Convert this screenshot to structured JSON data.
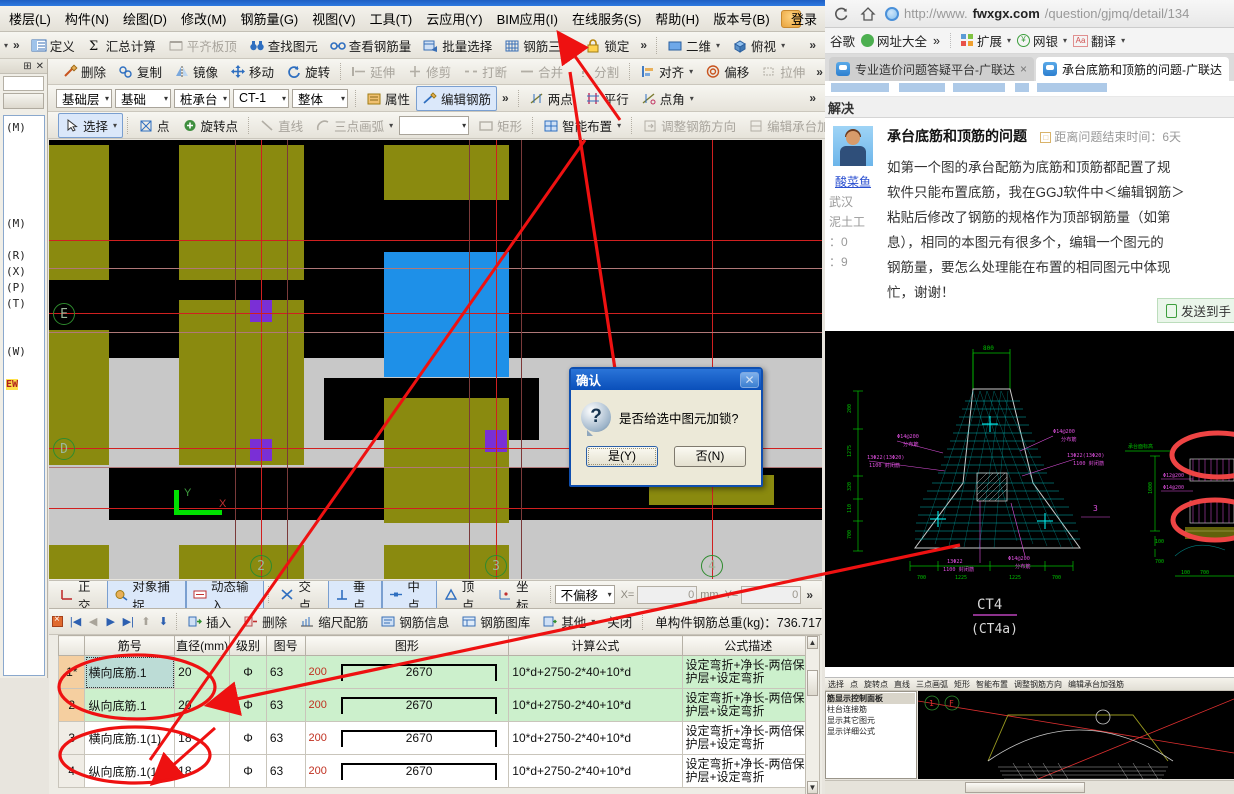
{
  "app": {
    "menu": [
      "楼层(L)",
      "构件(N)",
      "绘图(D)",
      "修改(M)",
      "钢筋量(G)",
      "视图(V)",
      "工具(T)",
      "云应用(Y)",
      "BIM应用(I)",
      "在线服务(S)",
      "帮助(H)",
      "版本号(B)"
    ],
    "login_label": "登录",
    "toolbar1": [
      {
        "label": "定义",
        "icon": "define-icon",
        "disabled": false
      },
      {
        "label": "汇总计算",
        "icon": "sigma-icon",
        "disabled": false
      },
      {
        "label": "平齐板顶",
        "icon": "align-slab-icon",
        "disabled": true
      },
      {
        "label": "查找图元",
        "icon": "binoculars-icon",
        "disabled": false
      },
      {
        "label": "查看钢筋量",
        "icon": "glasses-icon",
        "disabled": false
      },
      {
        "label": "批量选择",
        "icon": "batch-select-icon",
        "disabled": false
      },
      {
        "label": "钢筋三维",
        "icon": "rebar-3d-icon",
        "disabled": false
      },
      {
        "label": "锁定",
        "icon": "lock-icon",
        "disabled": false
      }
    ],
    "view_controls": [
      {
        "label": "二维",
        "icon": "plane-2d-icon"
      },
      {
        "label": "俯视",
        "icon": "cube-top-icon"
      }
    ],
    "toolbar2": [
      {
        "label": "删除",
        "icon": "delete-icon",
        "disabled": false
      },
      {
        "label": "复制",
        "icon": "copy-icon",
        "disabled": false
      },
      {
        "label": "镜像",
        "icon": "mirror-icon",
        "disabled": false
      },
      {
        "label": "移动",
        "icon": "move-icon",
        "disabled": false
      },
      {
        "label": "旋转",
        "icon": "rotate-icon",
        "disabled": false
      },
      {
        "label": "延伸",
        "icon": "extend-icon",
        "disabled": true
      },
      {
        "label": "修剪",
        "icon": "trim-icon",
        "disabled": true
      },
      {
        "label": "打断",
        "icon": "break-icon",
        "disabled": true
      },
      {
        "label": "合并",
        "icon": "merge-icon",
        "disabled": true
      },
      {
        "label": "分割",
        "icon": "split-icon",
        "disabled": true
      },
      {
        "label": "对齐",
        "icon": "align-icon",
        "disabled": false
      },
      {
        "label": "偏移",
        "icon": "offset-icon",
        "disabled": false
      },
      {
        "label": "拉伸",
        "icon": "stretch-icon",
        "disabled": true
      }
    ],
    "toolbar3_selects": [
      "基础层",
      "基础",
      "桩承台",
      "CT-1",
      "整体"
    ],
    "toolbar3_buttons": [
      {
        "label": "属性",
        "icon": "properties-icon",
        "selected": false
      },
      {
        "label": "编辑钢筋",
        "icon": "edit-rebar-icon",
        "selected": true
      }
    ],
    "toolbar3_right": [
      {
        "label": "两点",
        "icon": "two-point-icon"
      },
      {
        "label": "平行",
        "icon": "parallel-icon"
      },
      {
        "label": "点角",
        "icon": "point-angle-icon"
      }
    ],
    "toolbar4": [
      {
        "label": "选择",
        "icon": "cursor-icon",
        "disabled": false,
        "selected": true
      },
      {
        "label": "点",
        "icon": "point-icon",
        "disabled": false
      },
      {
        "label": "旋转点",
        "icon": "rotate-point-icon",
        "disabled": false
      },
      {
        "label": "直线",
        "icon": "line-icon",
        "disabled": true
      },
      {
        "label": "三点画弧",
        "icon": "arc-3point-icon",
        "disabled": true
      },
      {
        "label": "矩形",
        "icon": "rectangle-icon",
        "disabled": true
      },
      {
        "label": "智能布置",
        "icon": "smart-layout-icon",
        "disabled": false
      },
      {
        "label": "调整钢筋方向",
        "icon": "adjust-rebar-dir-icon",
        "disabled": true
      },
      {
        "label": "编辑承台加强筋",
        "icon": "edit-cap-rebar-icon",
        "disabled": true
      }
    ],
    "left_dock": {
      "pin_icon": "pin-icon",
      "close_icon": "close-icon",
      "tree_lines": [
        "",
        "(M)",
        "",
        "",
        "",
        "",
        "",
        "(M)",
        "",
        "(R)",
        "(X)",
        "(P)",
        "(T)",
        "",
        "",
        "(W)",
        "",
        "EW"
      ]
    },
    "snapbar": [
      {
        "label": "正交",
        "icon": "ortho-icon",
        "on": false
      },
      {
        "label": "对象捕捉",
        "icon": "object-snap-icon",
        "on": true
      },
      {
        "label": "动态输入",
        "icon": "dynamic-input-icon",
        "on": true
      },
      {
        "label": "交点",
        "icon": "intersection-icon",
        "on": false
      },
      {
        "label": "垂点",
        "icon": "perpendicular-icon",
        "on": true
      },
      {
        "label": "中点",
        "icon": "midpoint-icon",
        "on": true
      },
      {
        "label": "顶点",
        "icon": "vertex-icon",
        "on": false
      },
      {
        "label": "坐标",
        "icon": "coordinate-icon",
        "on": false
      }
    ],
    "offset_mode": "不偏移",
    "x_label": "X=",
    "x_value": "0",
    "unit": "mm",
    "y_label": "Y=",
    "y_value": "0",
    "cad": {
      "axis_labels": [
        "E",
        "D",
        "2",
        "3",
        "4"
      ],
      "ucs_x": "X",
      "ucs_y": "Y"
    },
    "dialog": {
      "title": "确认",
      "message": "是否给选中图元加锁?",
      "yes_label": "是(Y)",
      "no_label": "否(N)",
      "close_label": "✕",
      "question_icon": "question-icon"
    },
    "rebar_editor": {
      "toolbar": [
        {
          "label": "插入",
          "icon": "insert-row-icon"
        },
        {
          "label": "删除",
          "icon": "delete-row-icon"
        },
        {
          "label": "缩尺配筋",
          "icon": "scale-rebar-icon"
        },
        {
          "label": "钢筋信息",
          "icon": "rebar-info-icon"
        },
        {
          "label": "钢筋图库",
          "icon": "rebar-library-icon"
        },
        {
          "label": "其他",
          "icon": "other-icon"
        },
        {
          "label": "关闭",
          "icon": "close-panel-icon"
        }
      ],
      "total_label": "单构件钢筋总重(kg)：736.717",
      "columns": [
        "筋号",
        "直径(mm)",
        "级别",
        "图号",
        "图形",
        "计算公式",
        "公式描述"
      ],
      "rows": [
        {
          "num": "1*",
          "name": "横向底筋.1",
          "dia": "20",
          "grade": "Φ",
          "pic": "63",
          "mark": "200",
          "len": "2670",
          "formula": "10*d+2750-2*40+10*d",
          "desc": "设定弯折+净长-两倍保护层+设定弯折",
          "selected": true,
          "green": true
        },
        {
          "num": "2",
          "name": "纵向底筋.1",
          "dia": "20",
          "grade": "Φ",
          "pic": "63",
          "mark": "200",
          "len": "2670",
          "formula": "10*d+2750-2*40+10*d",
          "desc": "设定弯折+净长-两倍保护层+设定弯折",
          "selected": false,
          "green": true
        },
        {
          "num": "3",
          "name": "横向底筋.1(1)",
          "dia": "18",
          "grade": "Φ",
          "pic": "63",
          "mark": "200",
          "len": "2670",
          "formula": "10*d+2750-2*40+10*d",
          "desc": "设定弯折+净长-两倍保护层+设定弯折",
          "selected": false,
          "green": false
        },
        {
          "num": "4",
          "name": "纵向底筋.1(1)",
          "dia": "18",
          "grade": "Φ",
          "pic": "63",
          "mark": "200",
          "len": "2670",
          "formula": "10*d+2750-2*40+10*d",
          "desc": "设定弯折+净长-两倍保护层+设定弯折",
          "selected": false,
          "green": false
        }
      ]
    }
  },
  "browser": {
    "reload_icon": "reload-icon",
    "home_icon": "home-icon",
    "url_scheme": "http://www.",
    "url_host": "fwxgx.com",
    "url_path": "/question/gjmq/detail/134",
    "bookmarks": [
      {
        "label": "谷歌",
        "icon": "google-icon"
      },
      {
        "label": "网址大全",
        "icon": "nav-site-icon"
      },
      {
        "label": "»",
        "icon": "more-bookmarks-icon"
      }
    ],
    "ext_buttons": [
      {
        "label": "扩展",
        "icon": "extensions-icon"
      },
      {
        "label": "网银",
        "icon": "bank-icon"
      },
      {
        "label": "翻译",
        "icon": "translate-icon"
      }
    ],
    "tabs": [
      {
        "label": "专业造价问题答疑平台-广联达",
        "active": false,
        "close": "×"
      },
      {
        "label": "承台底筋和顶筋的问题-广联达",
        "active": true,
        "close": ""
      }
    ],
    "page_section_title": "解决",
    "question": {
      "title": "承台底筋和顶筋的问题",
      "deadline": "距离问题结束时间：6天",
      "body_lines": [
        "如第一个图的承台配筋为底筋和顶筋都配置了规",
        "软件只能布置底筋，我在GGJ软件中＜编辑钢筋＞",
        "粘贴后修改了钢筋的规格作为顶部钢筋量（如第",
        "息），相同的本图元有很多个，编辑一个图元的",
        "钢筋量，要怎么处理能在布置的相同图元中体现",
        "忙，谢谢！"
      ],
      "user": "酸菜鱼",
      "user_city": "武汉",
      "user_job": "泥土工",
      "meta1": "：0",
      "meta2": "：9",
      "send_mobile_label": "发送到手"
    },
    "cad_drawing": {
      "title_main": "CT4",
      "title_sub": "(CT4a)",
      "top_dim": "800",
      "left_dims": [
        "200",
        "1275",
        "320",
        "110",
        "700"
      ],
      "bottom_dims": [
        "700",
        "1225",
        "1225",
        "700"
      ],
      "annotations": [
        "Φ14@200 分布筋",
        "13Φ22(13Φ20) 1100 封闭筋",
        "Φ14@200 分布筋",
        "13Φ22(13Φ20) 1100 封闭筋",
        "13Φ22 1100 封闭筋",
        "Φ14@200 分布筋",
        "3"
      ],
      "right_annotations": [
        "承台面标高",
        "Φ12@200",
        "Φ14@200",
        "1000",
        "100",
        "700"
      ]
    },
    "ggj_screenshot": {
      "toolbar": [
        "选择",
        "点",
        "旋转点",
        "直线",
        "三点画弧",
        "矩形",
        "智能布置",
        "调整钢筋方向",
        "编辑承台加强筋"
      ],
      "panel_title": "筋显示控制面板",
      "panel_items": [
        "柱台连接筋",
        "显示其它图元",
        "显示详细公式"
      ],
      "axis_labels": [
        "1",
        "F"
      ]
    }
  },
  "colors": {
    "accent_blue": "#2a74d8",
    "annotation_red": "#ee1111",
    "cad_black": "#000000",
    "pile_olive": "#8a8a0f",
    "pile_blue": "#1e90e8",
    "column_purple": "#7a2fd6",
    "grid_red": "#d02020",
    "row_green": "#ccf0cc",
    "selected_cell": "#bcdcd6"
  }
}
